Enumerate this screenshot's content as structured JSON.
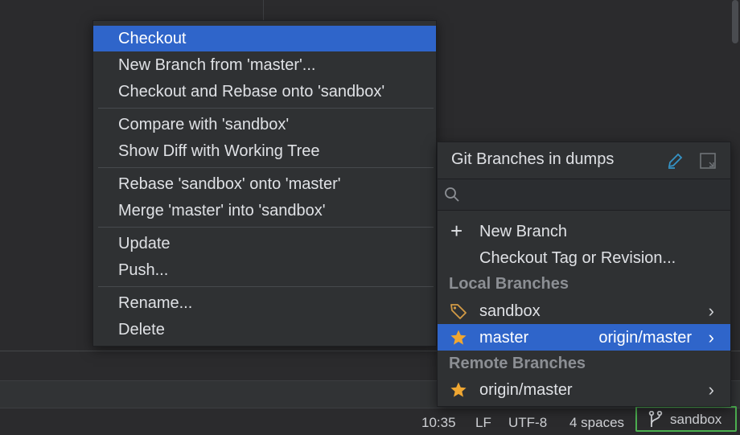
{
  "context_menu": {
    "items": [
      {
        "label": "Checkout",
        "selected": true
      },
      {
        "label": "New Branch from 'master'..."
      },
      {
        "label": "Checkout and Rebase onto 'sandbox'"
      },
      {
        "label": "Compare with 'sandbox'"
      },
      {
        "label": "Show Diff with Working Tree"
      },
      {
        "label": "Rebase 'sandbox' onto 'master'"
      },
      {
        "label": "Merge 'master' into 'sandbox'"
      },
      {
        "label": "Update"
      },
      {
        "label": "Push..."
      },
      {
        "label": "Rename..."
      },
      {
        "label": "Delete"
      }
    ]
  },
  "git_popup": {
    "title": "Git Branches in dumps",
    "search_placeholder": "",
    "actions": {
      "new_branch": "New Branch",
      "checkout_tag": "Checkout Tag or Revision..."
    },
    "local_section": "Local Branches",
    "local_branches": [
      {
        "name": "sandbox",
        "icon": "tag-icon"
      },
      {
        "name": "master",
        "icon": "star-icon",
        "tracking": "origin/master",
        "selected": true
      }
    ],
    "remote_section": "Remote Branches",
    "remote_branches": [
      {
        "name": "origin/master",
        "icon": "star-icon"
      }
    ],
    "colors": {
      "selection": "#2f65ca",
      "star": "#f0a732",
      "tag": "#d29a45",
      "edit": "#3592c4"
    }
  },
  "status_bar": {
    "time": "10:35",
    "line_separator": "LF",
    "encoding": "UTF-8",
    "indent": "4 spaces",
    "branch": "sandbox",
    "branch_border_color": "#4caf50"
  }
}
